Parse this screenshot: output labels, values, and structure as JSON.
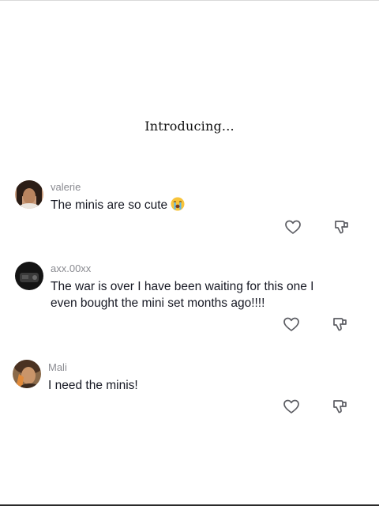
{
  "headline": "Introducing...",
  "comments": [
    {
      "username": "valerie",
      "text": "The minis are so cute",
      "emoji": "crying-face-emoji"
    },
    {
      "username": "axx.00xx",
      "text": "The war is over I have been waiting for this one I even bought the mini set months ago!!!!"
    },
    {
      "username": "Mali",
      "text": "I need the minis!"
    }
  ],
  "icons": {
    "like": "heart-outline-icon",
    "dislike": "thumbs-down-outline-icon"
  },
  "colors": {
    "username": "#8a8b91",
    "text": "#161823",
    "icon": "#5c5d63"
  }
}
